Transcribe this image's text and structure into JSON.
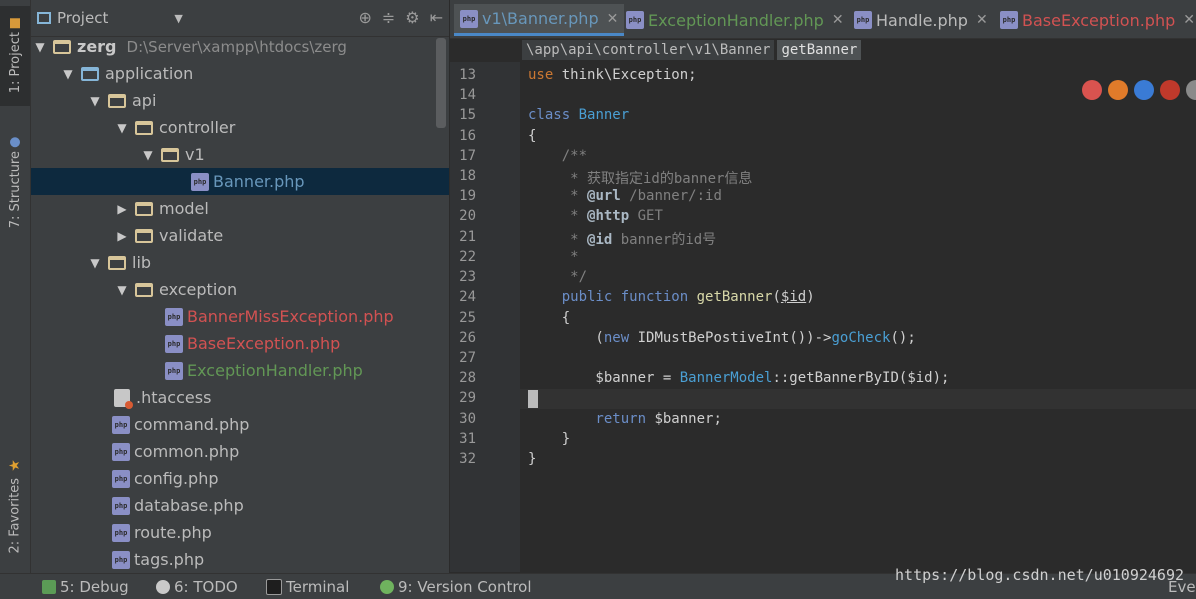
{
  "left_strip": {
    "project_tab": "1: Project",
    "structure_tab": "7: Structure",
    "favorites_tab": "2: Favorites"
  },
  "project_panel": {
    "title": "Project",
    "root_name": "zerg",
    "root_path": "D:\\Server\\xampp\\htdocs\\zerg",
    "items": [
      {
        "label": "application"
      },
      {
        "label": "api"
      },
      {
        "label": "controller"
      },
      {
        "label": "v1"
      },
      {
        "label": "Banner.php"
      },
      {
        "label": "model"
      },
      {
        "label": "validate"
      },
      {
        "label": "lib"
      },
      {
        "label": "exception"
      },
      {
        "label": "BannerMissException.php"
      },
      {
        "label": "BaseException.php"
      },
      {
        "label": "ExceptionHandler.php"
      },
      {
        "label": ".htaccess"
      },
      {
        "label": "command.php"
      },
      {
        "label": "common.php"
      },
      {
        "label": "config.php"
      },
      {
        "label": "database.php"
      },
      {
        "label": "route.php"
      },
      {
        "label": "tags.php"
      }
    ]
  },
  "editor_tabs": [
    {
      "label": "v1\\Banner.php"
    },
    {
      "label": "ExceptionHandler.php"
    },
    {
      "label": "Handle.php"
    },
    {
      "label": "BaseException.php"
    }
  ],
  "breadcrumb": {
    "path": "\\app\\api\\controller\\v1\\Banner",
    "function": "getBanner"
  },
  "line_numbers": [
    "13",
    "14",
    "15",
    "16",
    "17",
    "18",
    "19",
    "20",
    "21",
    "22",
    "23",
    "24",
    "25",
    "26",
    "27",
    "28",
    "29",
    "30",
    "31",
    "32"
  ],
  "code": {
    "l13_kw": "use",
    "l13_rest": " think\\Exception;",
    "l15_kw": "class",
    "l15_name": " Banner",
    "l16": "{",
    "l17": "    /**",
    "l18": "     * 获取指定id的banner信息",
    "l19_pre": "     * ",
    "l19_tag": "@url",
    "l19_rest": " /banner/:id",
    "l20_pre": "     * ",
    "l20_tag": "@http",
    "l20_rest": " GET",
    "l21_pre": "     * ",
    "l21_tag": "@id",
    "l21_rest": " banner的id号",
    "l22": "     *",
    "l23": "     */",
    "l24_kw": "    public function",
    "l24_fn": " getBanner",
    "l24_open": "(",
    "l24_var": "$id",
    "l24_close": ")",
    "l25": "    {",
    "l26_open": "        (",
    "l26_new": "new",
    "l26_cls": " IDMustBePostiveInt",
    "l26_mid": "())->",
    "l26_call": "goCheck",
    "l26_end": "();",
    "l28_var": "        $banner",
    "l28_eq": " = ",
    "l28_cls": "BannerModel",
    "l28_mid": "::getBannerByID(",
    "l28_arg": "$id",
    "l28_end": ");",
    "l30_kw": "        return",
    "l30_var": " $banner",
    "l30_end": ";",
    "l31": "    }",
    "l32": "}"
  },
  "status_bar": {
    "debug": "5: Debug",
    "todo": "6: TODO",
    "terminal": "Terminal",
    "vcs": "9: Version Control",
    "event": "Eve"
  },
  "watermark": "https://blog.csdn.net/u010924692"
}
